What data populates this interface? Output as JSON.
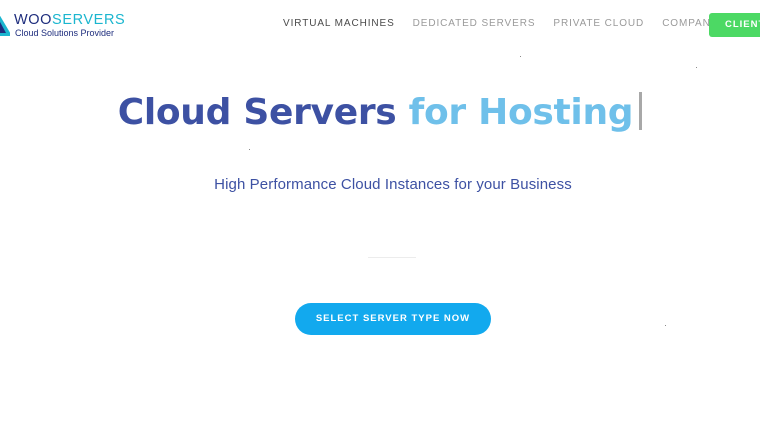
{
  "brand": {
    "name_part1": "WOO",
    "name_part2": "SERVERS",
    "tagline": "Cloud Solutions Provider",
    "primary_color": "#1e2d7d",
    "accent_color": "#1bb6cf"
  },
  "nav": {
    "items": [
      {
        "label": "VIRTUAL MACHINES",
        "active": true
      },
      {
        "label": "DEDICATED SERVERS",
        "active": false
      },
      {
        "label": "PRIVATE CLOUD",
        "active": false
      },
      {
        "label": "COMPANY",
        "active": false,
        "has_dropdown": true
      }
    ],
    "client_button": "CLIENT",
    "client_button_color": "#4cd964"
  },
  "hero": {
    "title_part1": "Cloud Servers",
    "title_part2": "for Hosting",
    "subtitle": "High Performance Cloud Instances for your Business",
    "cta_label": "SELECT SERVER TYPE NOW",
    "cta_color": "#12a9ee"
  },
  "icons": {
    "logo": "woo-logo-icon",
    "dropdown": "caret-down-icon",
    "text_cursor": "text-cursor-icon"
  }
}
